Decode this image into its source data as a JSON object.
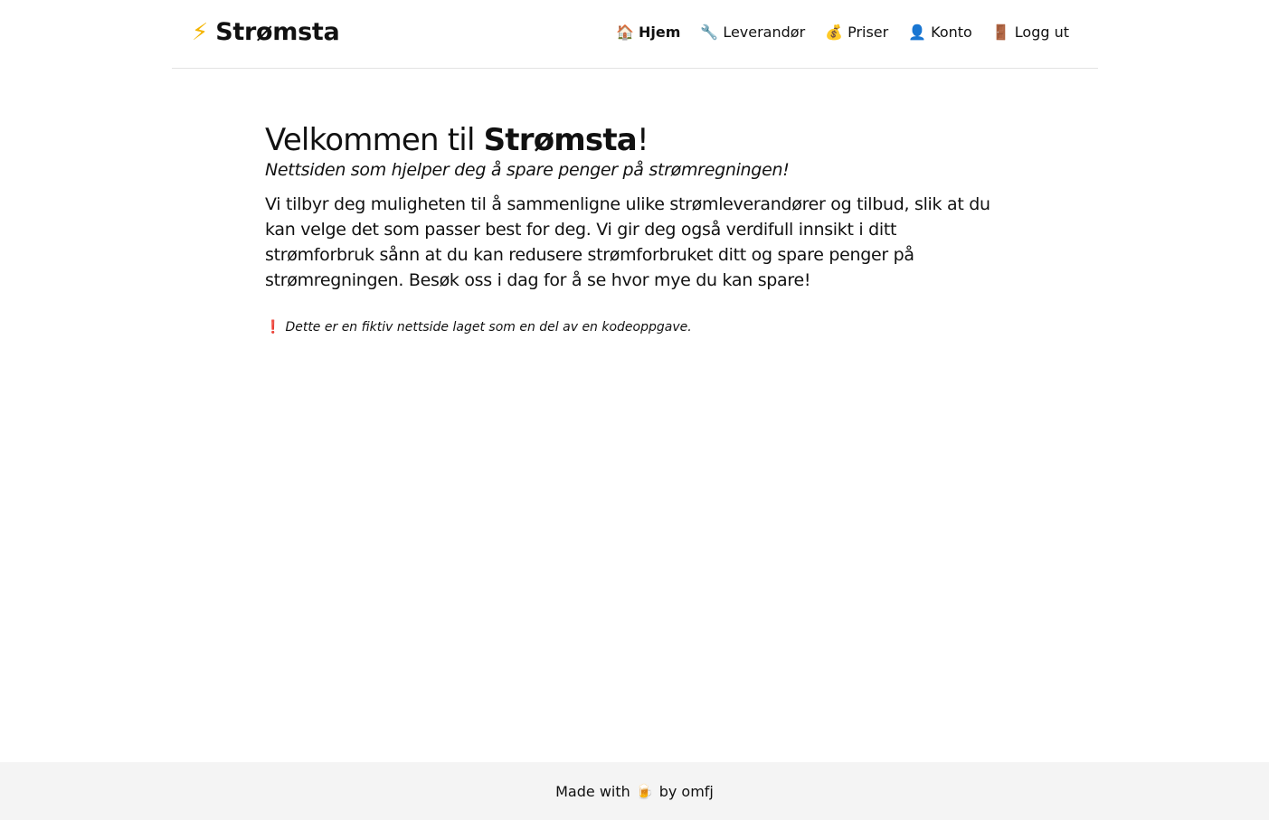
{
  "brand": {
    "icon": "⚡",
    "icon_name": "lightning-icon",
    "name": "Strømsta"
  },
  "nav": {
    "items": [
      {
        "icon": "🏠",
        "icon_name": "house-icon",
        "label": "Hjem",
        "active": true
      },
      {
        "icon": "🔧",
        "icon_name": "wrench-icon",
        "label": "Leverandør",
        "active": false
      },
      {
        "icon": "💰",
        "icon_name": "money-bag-icon",
        "label": "Priser",
        "active": false
      },
      {
        "icon": "👤",
        "icon_name": "user-icon",
        "label": "Konto",
        "active": false
      },
      {
        "icon": "🚪",
        "icon_name": "door-icon",
        "label": "Logg ut",
        "active": false
      }
    ]
  },
  "main": {
    "headline_prefix": "Velkommen til ",
    "headline_brand": "Strømsta",
    "headline_suffix": "!",
    "tagline": "Nettsiden som hjelper deg å spare penger på strømregningen!",
    "intro": "Vi tilbyr deg muligheten til å sammenligne ulike strømleverandører og tilbud, slik at du kan velge det som passer best for deg. Vi gir deg også verdifull innsikt i ditt strømforbruk sånn at du kan redusere strømforbruket ditt og spare penger på strømregningen. Besøk oss i dag for å se hvor mye du kan spare!",
    "disclaimer_icon": "❗",
    "disclaimer_icon_name": "exclamation-icon",
    "disclaimer": "Dette er en fiktiv nettside laget som en del av en kodeoppgave."
  },
  "footer": {
    "prefix": "Made with",
    "icon": "🍺",
    "icon_name": "beer-icon",
    "suffix": "by omfj"
  },
  "colors": {
    "background": "#ffffff",
    "footer_background": "#f4f4f4",
    "divider": "#e3e3e3",
    "brand_bolt": "#f4b400",
    "warning": "#d20a0a"
  }
}
